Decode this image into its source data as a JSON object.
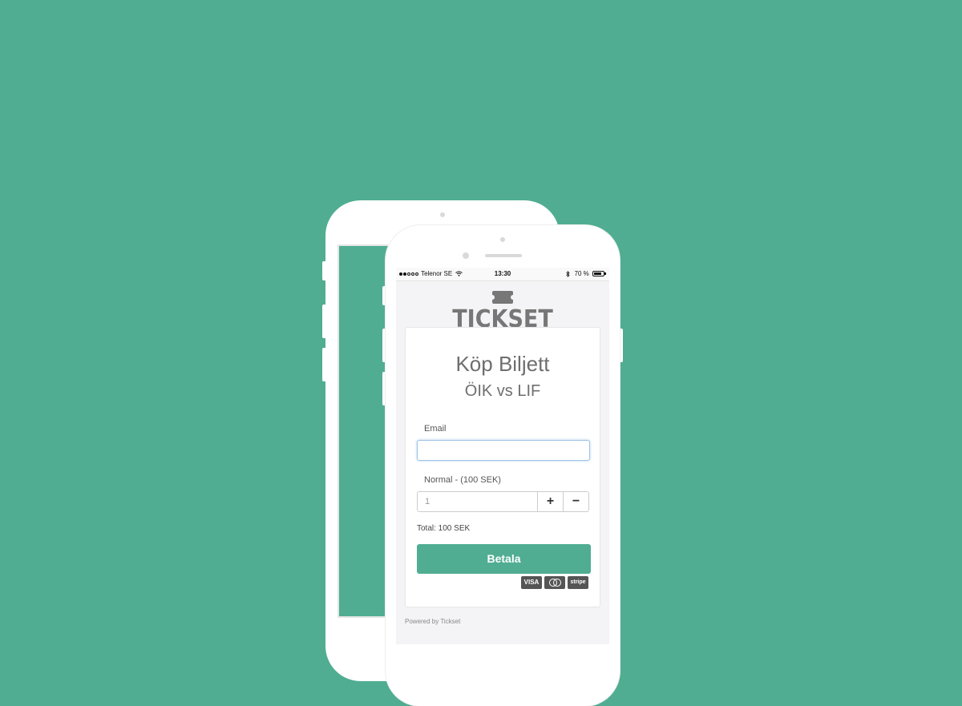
{
  "status_bar": {
    "carrier": "Telenor SE",
    "time": "13:30",
    "battery": "70 %",
    "signal_icon": "signal-dots-icon",
    "wifi_icon": "wifi-icon",
    "bluetooth_icon": "bluetooth-icon"
  },
  "brand": {
    "logo_text": "TICKSET",
    "logo_icon": "ticket-icon"
  },
  "form": {
    "title": "Köp Biljett",
    "event": "ÖIK vs LIF",
    "email_label": "Email",
    "email_value": "",
    "ticket_label": "Normal - (100 SEK)",
    "quantity": "1",
    "plus_label": "+",
    "minus_label": "−",
    "total": "Total: 100 SEK",
    "pay_button": "Betala",
    "payment_badges": [
      "VISA",
      "",
      "stripe"
    ]
  },
  "footer": {
    "powered_by": "Powered by Tickset"
  },
  "colors": {
    "background": "#50ad92",
    "accent": "#50ad92"
  }
}
